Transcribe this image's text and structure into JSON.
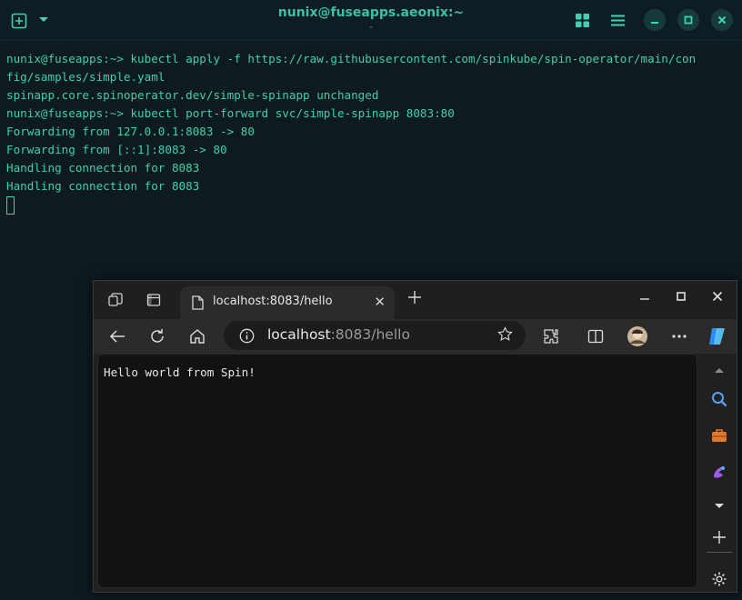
{
  "terminal": {
    "title": "nunix@fuseapps.aeonix:~",
    "title_sub": "⌄",
    "lines": [
      "nunix@fuseapps:~> kubectl apply -f https://raw.githubusercontent.com/spinkube/spin-operator/main/con",
      "fig/samples/simple.yaml",
      "spinapp.core.spinoperator.dev/simple-spinapp unchanged",
      "nunix@fuseapps:~> kubectl port-forward svc/simple-spinapp 8083:80",
      "Forwarding from 127.0.0.1:8083 -> 80",
      "Forwarding from [::1]:8083 -> 80",
      "Handling connection for 8083",
      "Handling connection for 8083"
    ]
  },
  "browser": {
    "tab_title": "localhost:8083/hello",
    "url_host": "localhost",
    "url_rest": ":8083/hello",
    "page_text": "Hello world from Spin!"
  },
  "colors": {
    "terminal_text": "#3fd0ad",
    "terminal_bg": "#0d1a20",
    "browser_bg": "#202020"
  }
}
